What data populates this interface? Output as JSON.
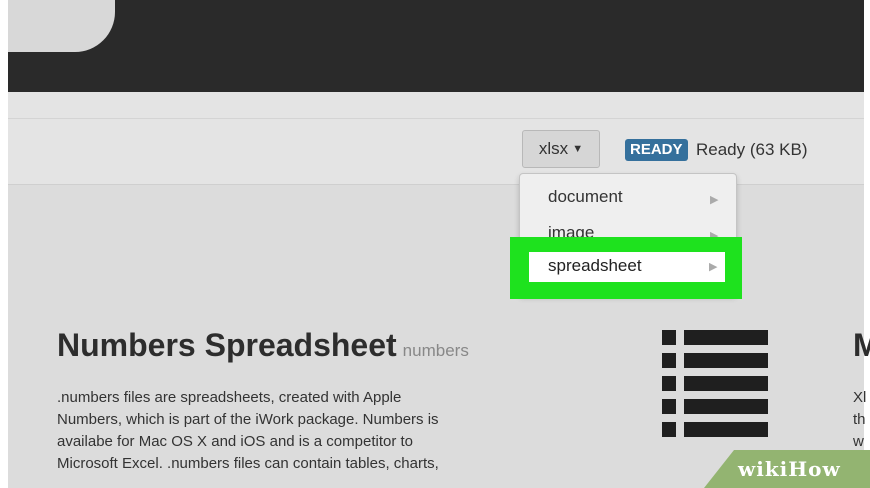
{
  "toolbar": {
    "format_select": "xlsx",
    "status_badge": "READY",
    "status_text": "Ready (63 KB)"
  },
  "dropdown": {
    "items": [
      {
        "label": "document"
      },
      {
        "label": "image"
      },
      {
        "label": "spreadsheet"
      }
    ],
    "highlighted_item": "spreadsheet"
  },
  "format_info": {
    "title": "Numbers Spreadsheet",
    "extension": "numbers",
    "description_lines": [
      ".numbers files are spreadsheets, created with Apple",
      "Numbers, which is part of the iWork package. Numbers is",
      "availabe for Mac OS X and iOS and is a competitor to",
      "Microsoft Excel. .numbers files can contain tables, charts,"
    ]
  },
  "next_format": {
    "title_fragment": "M",
    "text_fragments": [
      "Xl",
      "th",
      "w"
    ]
  },
  "watermark": {
    "text": "wikiHow"
  },
  "colors": {
    "highlight": "#1ee21e",
    "badge": "#35709c",
    "header": "#2a2a2a",
    "watermark": "#93b471"
  }
}
